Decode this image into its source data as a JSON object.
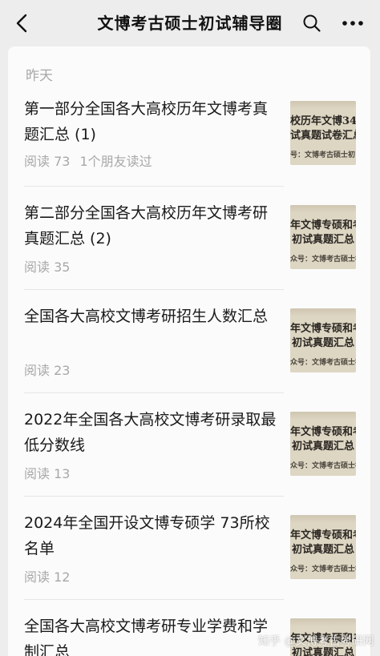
{
  "header": {
    "title": "文博考古硕士初试辅导圈",
    "back_icon": "chevron-left-icon",
    "search_icon": "search-icon",
    "more_icon": "more-dots-icon"
  },
  "section_label": "昨天",
  "articles": [
    {
      "title": "第一部分全国各大高校历年文博考真题汇总 (1)",
      "reads": "阅读 73",
      "friends": "1个朋友读过",
      "thumb": {
        "line1": "校历年文博34",
        "line2": "试真题试卷汇总",
        "line3": "号：文博考古硕士初"
      }
    },
    {
      "title": "第二部分全国各大高校历年文博考研真题汇总 (2)",
      "reads": "阅读 35",
      "friends": "",
      "thumb": {
        "line1": "年文博专硕和考",
        "line2": "初试真题汇总",
        "line3": "众号：文博考古硕士初"
      }
    },
    {
      "title": "全国各大高校文博考研招生人数汇总",
      "reads": "阅读 23",
      "friends": "",
      "thumb": {
        "line1": "年文博专硕和考",
        "line2": "初试真题汇总",
        "line3": "众号：文博考古硕士初"
      }
    },
    {
      "title": "2022年全国各大高校文博考研录取最低分数线",
      "reads": "阅读 13",
      "friends": "",
      "thumb": {
        "line1": "年文博专硕和考",
        "line2": "初试真题汇总",
        "line3": "众号：文博考古硕士初"
      }
    },
    {
      "title": "2024年全国开设文博专硕学 73所校名单",
      "reads": "阅读 12",
      "friends": "",
      "thumb": {
        "line1": "年文博专硕和考",
        "line2": "初试真题汇总",
        "line3": "众号：文博考古硕士初"
      }
    },
    {
      "title": "全国各大高校文博考研专业学费和学制汇总",
      "reads": "",
      "friends": "",
      "thumb": {
        "line1": "年文博专硕和考",
        "line2": "初试真题汇总",
        "line3": ""
      }
    }
  ],
  "watermark": "知乎 @文博考古考研网"
}
